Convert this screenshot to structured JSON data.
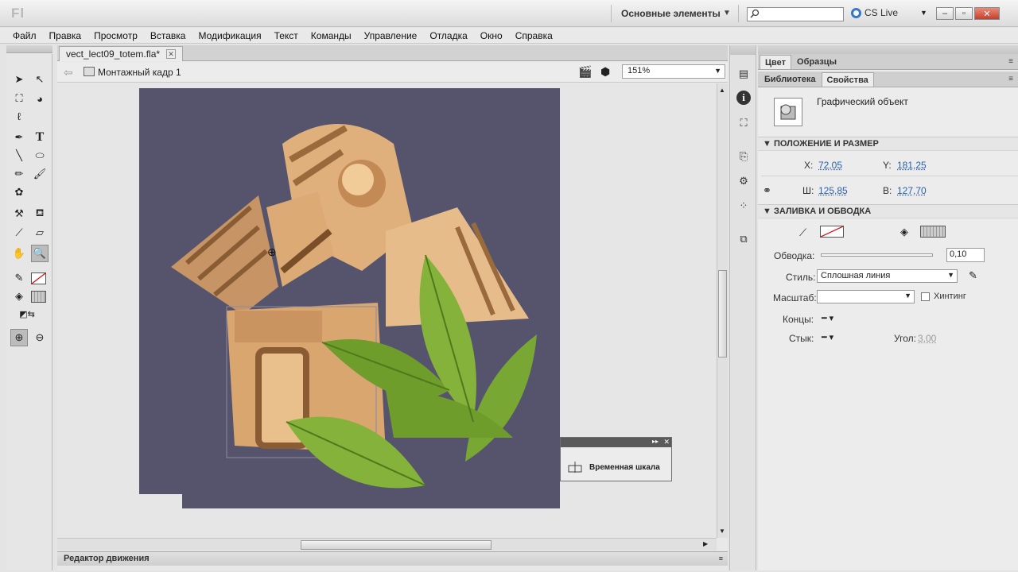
{
  "app": {
    "logo": "Fl",
    "workspace": "Основные элементы",
    "cs_live": "CS Live"
  },
  "menu": [
    "Файл",
    "Правка",
    "Просмотр",
    "Вставка",
    "Модификация",
    "Текст",
    "Команды",
    "Управление",
    "Отладка",
    "Окно",
    "Справка"
  ],
  "document": {
    "tab_title": "vect_lect09_totem.fla*",
    "scene": "Монтажный кадр 1",
    "zoom": "151%"
  },
  "stage": {
    "background": "#56546d"
  },
  "floating_panel": {
    "label": "Временная шкала"
  },
  "bottom_panel": {
    "label": "Редактор движения"
  },
  "right_panel": {
    "tabs_top": [
      "Цвет",
      "Образцы"
    ],
    "tabs_main": [
      "Библиотека",
      "Свойства"
    ],
    "object_type": "Графический объект",
    "position_section": "ПОЛОЖЕНИЕ И РАЗМЕР",
    "x_label": "X:",
    "x_value": "72,05",
    "y_label": "Y:",
    "y_value": "181,25",
    "w_label": "Ш:",
    "w_value": "125,85",
    "h_label": "В:",
    "h_value": "127,70",
    "fill_section": "ЗАЛИВКА И ОБВОДКА",
    "stroke_label": "Обводка:",
    "stroke_value": "0,10",
    "style_label": "Стиль:",
    "style_value": "Сплошная линия",
    "scale_label": "Масштаб:",
    "scale_value": "",
    "hinting_label": "Хинтинг",
    "caps_label": "Концы:",
    "join_label": "Стык:",
    "miter_label": "Угол:",
    "miter_value": "3,00"
  },
  "icons": {
    "search": "search-icon",
    "link": "link-icon",
    "pencil": "pencil-icon"
  }
}
